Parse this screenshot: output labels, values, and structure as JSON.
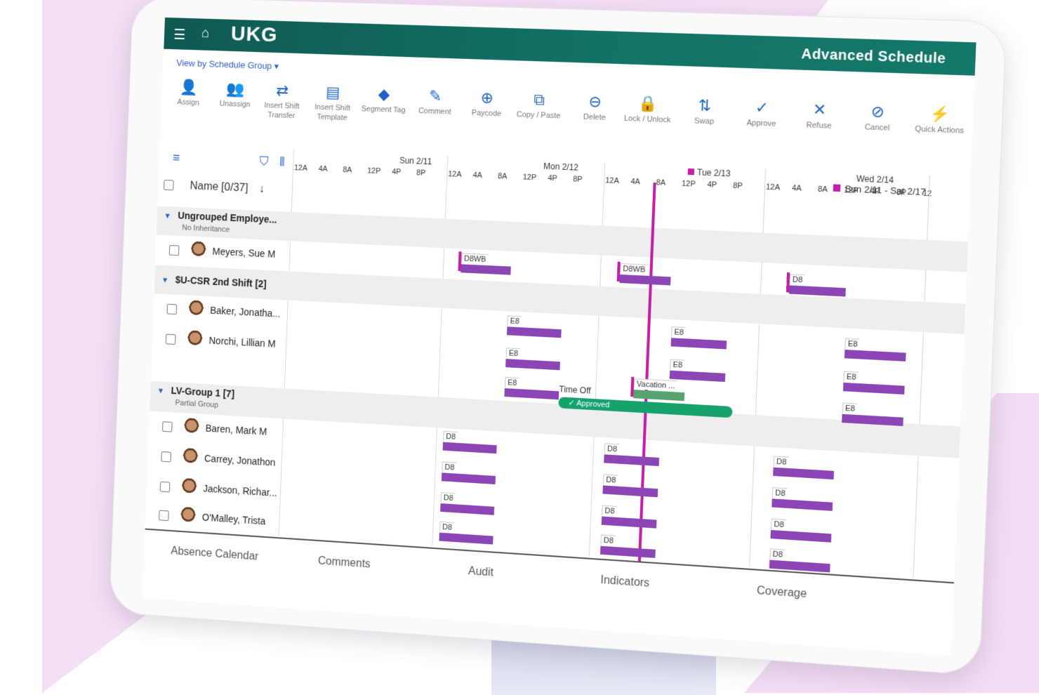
{
  "header": {
    "menu_icon": "hamburger-menu-icon",
    "home_icon": "home-icon",
    "logo": "UKG",
    "title": "Advanced Schedule"
  },
  "view_by": "View by Schedule Group",
  "toolbar": {
    "buttons": [
      {
        "label": "Assign",
        "icon": "assign-icon"
      },
      {
        "label": "Unassign",
        "icon": "unassign-icon"
      },
      {
        "label": "Insert Shift Transfer",
        "icon": "transfer-icon"
      },
      {
        "label": "Insert Shift Template",
        "icon": "template-icon"
      },
      {
        "label": "Segment Tag",
        "icon": "tag-icon"
      },
      {
        "label": "Comment",
        "icon": "comment-icon"
      },
      {
        "label": "Paycode",
        "icon": "paycode-icon"
      },
      {
        "label": "Copy / Paste",
        "icon": "copy-icon"
      },
      {
        "label": "Delete",
        "icon": "delete-icon"
      },
      {
        "label": "Lock / Unlock",
        "icon": "lock-icon"
      },
      {
        "label": "Swap",
        "icon": "swap-icon"
      },
      {
        "label": "Approve",
        "icon": "check-icon"
      },
      {
        "label": "Refuse",
        "icon": "x-icon"
      },
      {
        "label": "Cancel",
        "icon": "cancel-icon"
      },
      {
        "label": "Quick Actions",
        "icon": "lightning-icon"
      }
    ]
  },
  "grid": {
    "name_header": "Name",
    "name_count": "[0/37]",
    "date_range": "Sun 2/11 - Sat 2/17",
    "days": [
      {
        "label": "Sun 2/11"
      },
      {
        "label": "Mon 2/12"
      },
      {
        "label": "Tue 2/13"
      },
      {
        "label": "Wed 2/14"
      }
    ],
    "hours": [
      "12A",
      "4A",
      "8A",
      "12P",
      "4P",
      "8P"
    ],
    "extra_hour": "12",
    "groups": [
      {
        "name": "Ungrouped Employe...",
        "sub": "No Inheritance"
      },
      {
        "name": "$U-CSR 2nd Shift [2]",
        "sub": ""
      },
      {
        "name": "LV-Group 1 [7]",
        "sub": "Partial Group"
      }
    ],
    "employees": [
      {
        "name": "Meyers, Sue M"
      },
      {
        "name": "Baker, Jonatha..."
      },
      {
        "name": "Norchi, Lillian M"
      },
      {
        "name": "Baren, Mark M"
      },
      {
        "name": "Carrey, Jonathon"
      },
      {
        "name": "Jackson, Richar..."
      },
      {
        "name": "O'Malley, Trista"
      }
    ],
    "shift_labels": {
      "d8wb": "D8WB",
      "e8": "E8",
      "d8": "D8",
      "vacation": "Vacation ..."
    },
    "time_off": "Time Off",
    "approved": "Approved"
  },
  "bottom_tabs": [
    "Absence Calendar",
    "Comments",
    "Audit",
    "Indicators",
    "Coverage"
  ],
  "colors": {
    "header": "#137466",
    "shift": "#8b45b5",
    "today": "#c41ea7",
    "approved": "#15a36b"
  }
}
